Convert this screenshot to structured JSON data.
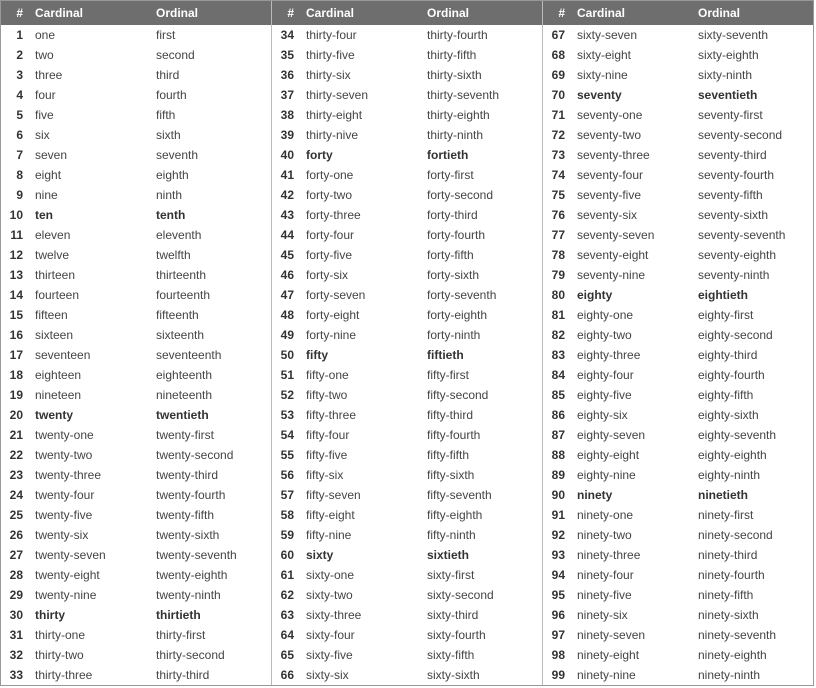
{
  "headers": {
    "num": "#",
    "cardinal": "Cardinal",
    "ordinal": "Ordinal"
  },
  "columns": [
    {
      "rows": [
        {
          "n": "1",
          "c": "one",
          "o": "first",
          "b": false
        },
        {
          "n": "2",
          "c": "two",
          "o": "second",
          "b": false
        },
        {
          "n": "3",
          "c": "three",
          "o": "third",
          "b": false
        },
        {
          "n": "4",
          "c": "four",
          "o": "fourth",
          "b": false
        },
        {
          "n": "5",
          "c": "five",
          "o": "fifth",
          "b": false
        },
        {
          "n": "6",
          "c": "six",
          "o": "sixth",
          "b": false
        },
        {
          "n": "7",
          "c": "seven",
          "o": "seventh",
          "b": false
        },
        {
          "n": "8",
          "c": "eight",
          "o": "eighth",
          "b": false
        },
        {
          "n": "9",
          "c": "nine",
          "o": "ninth",
          "b": false
        },
        {
          "n": "10",
          "c": "ten",
          "o": "tenth",
          "b": true
        },
        {
          "n": "11",
          "c": "eleven",
          "o": "eleventh",
          "b": false
        },
        {
          "n": "12",
          "c": "twelve",
          "o": "twelfth",
          "b": false
        },
        {
          "n": "13",
          "c": "thirteen",
          "o": "thirteenth",
          "b": false
        },
        {
          "n": "14",
          "c": "fourteen",
          "o": "fourteenth",
          "b": false
        },
        {
          "n": "15",
          "c": "fifteen",
          "o": "fifteenth",
          "b": false
        },
        {
          "n": "16",
          "c": "sixteen",
          "o": "sixteenth",
          "b": false
        },
        {
          "n": "17",
          "c": "seventeen",
          "o": "seventeenth",
          "b": false
        },
        {
          "n": "18",
          "c": "eighteen",
          "o": "eighteenth",
          "b": false
        },
        {
          "n": "19",
          "c": "nineteen",
          "o": "nineteenth",
          "b": false
        },
        {
          "n": "20",
          "c": "twenty",
          "o": "twentieth",
          "b": true
        },
        {
          "n": "21",
          "c": "twenty-one",
          "o": "twenty-first",
          "b": false
        },
        {
          "n": "22",
          "c": "twenty-two",
          "o": "twenty-second",
          "b": false
        },
        {
          "n": "23",
          "c": "twenty-three",
          "o": "twenty-third",
          "b": false
        },
        {
          "n": "24",
          "c": "twenty-four",
          "o": "twenty-fourth",
          "b": false
        },
        {
          "n": "25",
          "c": "twenty-five",
          "o": "twenty-fifth",
          "b": false
        },
        {
          "n": "26",
          "c": "twenty-six",
          "o": "twenty-sixth",
          "b": false
        },
        {
          "n": "27",
          "c": "twenty-seven",
          "o": "twenty-seventh",
          "b": false
        },
        {
          "n": "28",
          "c": "twenty-eight",
          "o": "twenty-eighth",
          "b": false
        },
        {
          "n": "29",
          "c": "twenty-nine",
          "o": "twenty-ninth",
          "b": false
        },
        {
          "n": "30",
          "c": "thirty",
          "o": "thirtieth",
          "b": true
        },
        {
          "n": "31",
          "c": "thirty-one",
          "o": "thirty-first",
          "b": false
        },
        {
          "n": "32",
          "c": "thirty-two",
          "o": "thirty-second",
          "b": false
        },
        {
          "n": "33",
          "c": "thirty-three",
          "o": "thirty-third",
          "b": false
        }
      ]
    },
    {
      "rows": [
        {
          "n": "34",
          "c": "thirty-four",
          "o": "thirty-fourth",
          "b": false
        },
        {
          "n": "35",
          "c": "thirty-five",
          "o": "thirty-fifth",
          "b": false
        },
        {
          "n": "36",
          "c": "thirty-six",
          "o": "thirty-sixth",
          "b": false
        },
        {
          "n": "37",
          "c": "thirty-seven",
          "o": "thirty-seventh",
          "b": false
        },
        {
          "n": "38",
          "c": "thirty-eight",
          "o": "thirty-eighth",
          "b": false
        },
        {
          "n": "39",
          "c": "thirty-nive",
          "o": "thirty-ninth",
          "b": false
        },
        {
          "n": "40",
          "c": "forty",
          "o": "fortieth",
          "b": true
        },
        {
          "n": "41",
          "c": "forty-one",
          "o": "forty-first",
          "b": false
        },
        {
          "n": "42",
          "c": "forty-two",
          "o": "forty-second",
          "b": false
        },
        {
          "n": "43",
          "c": "forty-three",
          "o": "forty-third",
          "b": false
        },
        {
          "n": "44",
          "c": "forty-four",
          "o": "forty-fourth",
          "b": false
        },
        {
          "n": "45",
          "c": "forty-five",
          "o": "forty-fifth",
          "b": false
        },
        {
          "n": "46",
          "c": "forty-six",
          "o": "forty-sixth",
          "b": false
        },
        {
          "n": "47",
          "c": "forty-seven",
          "o": "forty-seventh",
          "b": false
        },
        {
          "n": "48",
          "c": "forty-eight",
          "o": "forty-eighth",
          "b": false
        },
        {
          "n": "49",
          "c": "forty-nine",
          "o": "forty-ninth",
          "b": false
        },
        {
          "n": "50",
          "c": "fifty",
          "o": "fiftieth",
          "b": true
        },
        {
          "n": "51",
          "c": "fifty-one",
          "o": "fifty-first",
          "b": false
        },
        {
          "n": "52",
          "c": "fifty-two",
          "o": "fifty-second",
          "b": false
        },
        {
          "n": "53",
          "c": "fifty-three",
          "o": "fifty-third",
          "b": false
        },
        {
          "n": "54",
          "c": "fifty-four",
          "o": "fifty-fourth",
          "b": false
        },
        {
          "n": "55",
          "c": "fifty-five",
          "o": "fifty-fifth",
          "b": false
        },
        {
          "n": "56",
          "c": "fifty-six",
          "o": "fifty-sixth",
          "b": false
        },
        {
          "n": "57",
          "c": "fifty-seven",
          "o": "fifty-seventh",
          "b": false
        },
        {
          "n": "58",
          "c": "fifty-eight",
          "o": "fifty-eighth",
          "b": false
        },
        {
          "n": "59",
          "c": "fifty-nine",
          "o": "fifty-ninth",
          "b": false
        },
        {
          "n": "60",
          "c": "sixty",
          "o": "sixtieth",
          "b": true
        },
        {
          "n": "61",
          "c": "sixty-one",
          "o": "sixty-first",
          "b": false
        },
        {
          "n": "62",
          "c": "sixty-two",
          "o": "sixty-second",
          "b": false
        },
        {
          "n": "63",
          "c": "sixty-three",
          "o": "sixty-third",
          "b": false
        },
        {
          "n": "64",
          "c": "sixty-four",
          "o": "sixty-fourth",
          "b": false
        },
        {
          "n": "65",
          "c": "sixty-five",
          "o": "sixty-fifth",
          "b": false
        },
        {
          "n": "66",
          "c": "sixty-six",
          "o": "sixty-sixth",
          "b": false
        }
      ]
    },
    {
      "rows": [
        {
          "n": "67",
          "c": "sixty-seven",
          "o": "sixty-seventh",
          "b": false
        },
        {
          "n": "68",
          "c": "sixty-eight",
          "o": "sixty-eighth",
          "b": false
        },
        {
          "n": "69",
          "c": "sixty-nine",
          "o": "sixty-ninth",
          "b": false
        },
        {
          "n": "70",
          "c": "seventy",
          "o": "seventieth",
          "b": true
        },
        {
          "n": "71",
          "c": "seventy-one",
          "o": "seventy-first",
          "b": false
        },
        {
          "n": "72",
          "c": "seventy-two",
          "o": "seventy-second",
          "b": false
        },
        {
          "n": "73",
          "c": "seventy-three",
          "o": "seventy-third",
          "b": false
        },
        {
          "n": "74",
          "c": "seventy-four",
          "o": "seventy-fourth",
          "b": false
        },
        {
          "n": "75",
          "c": "seventy-five",
          "o": "seventy-fifth",
          "b": false
        },
        {
          "n": "76",
          "c": "seventy-six",
          "o": "seventy-sixth",
          "b": false
        },
        {
          "n": "77",
          "c": "seventy-seven",
          "o": "seventy-seventh",
          "b": false
        },
        {
          "n": "78",
          "c": "seventy-eight",
          "o": "seventy-eighth",
          "b": false
        },
        {
          "n": "79",
          "c": "seventy-nine",
          "o": "seventy-ninth",
          "b": false
        },
        {
          "n": "80",
          "c": "eighty",
          "o": "eightieth",
          "b": true
        },
        {
          "n": "81",
          "c": "eighty-one",
          "o": "eighty-first",
          "b": false
        },
        {
          "n": "82",
          "c": "eighty-two",
          "o": "eighty-second",
          "b": false
        },
        {
          "n": "83",
          "c": "eighty-three",
          "o": "eighty-third",
          "b": false
        },
        {
          "n": "84",
          "c": "eighty-four",
          "o": "eighty-fourth",
          "b": false
        },
        {
          "n": "85",
          "c": "eighty-five",
          "o": "eighty-fifth",
          "b": false
        },
        {
          "n": "86",
          "c": "eighty-six",
          "o": "eighty-sixth",
          "b": false
        },
        {
          "n": "87",
          "c": "eighty-seven",
          "o": "eighty-seventh",
          "b": false
        },
        {
          "n": "88",
          "c": "eighty-eight",
          "o": "eighty-eighth",
          "b": false
        },
        {
          "n": "89",
          "c": "eighty-nine",
          "o": "eighty-ninth",
          "b": false
        },
        {
          "n": "90",
          "c": "ninety",
          "o": "ninetieth",
          "b": true
        },
        {
          "n": "91",
          "c": "ninety-one",
          "o": "ninety-first",
          "b": false
        },
        {
          "n": "92",
          "c": "ninety-two",
          "o": "ninety-second",
          "b": false
        },
        {
          "n": "93",
          "c": "ninety-three",
          "o": "ninety-third",
          "b": false
        },
        {
          "n": "94",
          "c": "ninety-four",
          "o": "ninety-fourth",
          "b": false
        },
        {
          "n": "95",
          "c": "ninety-five",
          "o": "ninety-fifth",
          "b": false
        },
        {
          "n": "96",
          "c": "ninety-six",
          "o": "ninety-sixth",
          "b": false
        },
        {
          "n": "97",
          "c": "ninety-seven",
          "o": "ninety-seventh",
          "b": false
        },
        {
          "n": "98",
          "c": "ninety-eight",
          "o": "ninety-eighth",
          "b": false
        },
        {
          "n": "99",
          "c": "ninety-nine",
          "o": "ninety-ninth",
          "b": false
        }
      ]
    }
  ]
}
